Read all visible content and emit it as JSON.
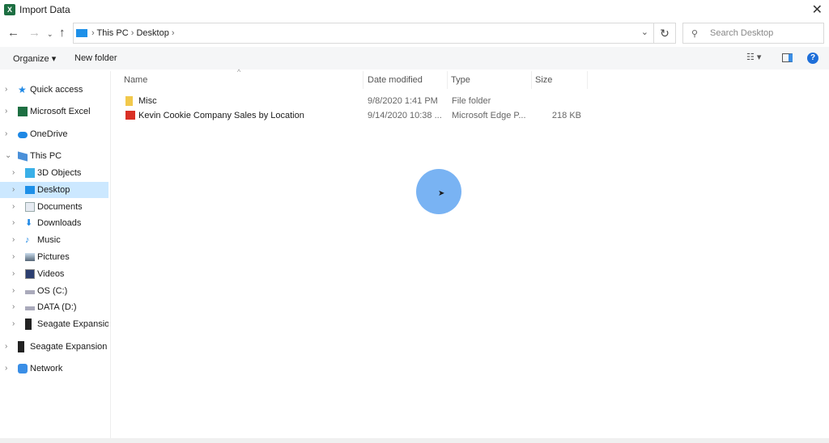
{
  "window": {
    "title": "Import Data",
    "icon": "excel-icon",
    "close": "✕"
  },
  "address": {
    "crumbs": [
      "This PC",
      "Desktop"
    ],
    "search_placeholder": "Search Desktop"
  },
  "toolbar": {
    "organize": "Organize ▾",
    "new_folder": "New folder"
  },
  "sidebar": {
    "items": [
      {
        "label": "Quick access",
        "icon": "star-icon",
        "indent": 0,
        "expanded": false
      },
      {
        "label": "Microsoft Excel",
        "icon": "excel-icon",
        "indent": 0,
        "expanded": false
      },
      {
        "label": "OneDrive",
        "icon": "cloud-icon",
        "indent": 0,
        "expanded": false
      },
      {
        "label": "This PC",
        "icon": "computer-icon",
        "indent": 0,
        "expanded": true
      },
      {
        "label": "3D Objects",
        "icon": "cube-icon",
        "indent": 1
      },
      {
        "label": "Desktop",
        "icon": "desktop-icon",
        "indent": 1,
        "selected": true
      },
      {
        "label": "Documents",
        "icon": "document-icon",
        "indent": 1
      },
      {
        "label": "Downloads",
        "icon": "download-icon",
        "indent": 1
      },
      {
        "label": "Music",
        "icon": "music-icon",
        "indent": 1
      },
      {
        "label": "Pictures",
        "icon": "picture-icon",
        "indent": 1
      },
      {
        "label": "Videos",
        "icon": "video-icon",
        "indent": 1
      },
      {
        "label": "OS (C:)",
        "icon": "drive-icon",
        "indent": 1
      },
      {
        "label": "DATA (D:)",
        "icon": "drive-icon",
        "indent": 1
      },
      {
        "label": "Seagate Expansion Drive",
        "icon": "external-drive-icon",
        "indent": 1
      },
      {
        "label": "Seagate Expansion Drive",
        "icon": "external-drive-icon",
        "indent": 0
      },
      {
        "label": "Network",
        "icon": "network-icon",
        "indent": 0
      }
    ]
  },
  "columns": {
    "name": "Name",
    "date": "Date modified",
    "type": "Type",
    "size": "Size"
  },
  "files": [
    {
      "name": "Misc",
      "date": "9/8/2020 1:41 PM",
      "type": "File folder",
      "size": "",
      "icon": "folder-icon"
    },
    {
      "name": "Kevin Cookie Company Sales by Location",
      "date": "9/14/2020 10:38 ...",
      "type": "Microsoft Edge P...",
      "size": "218 KB",
      "icon": "pdf-icon"
    }
  ],
  "colors": {
    "accent": "#1e90e8",
    "selection": "#cce8ff",
    "cursor_highlight": "#6aabf2"
  }
}
